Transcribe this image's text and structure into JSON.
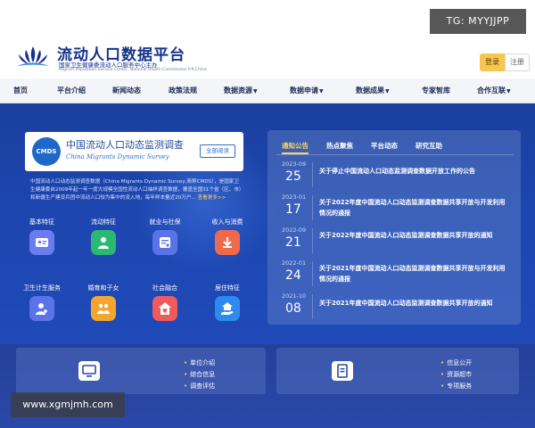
{
  "watermarks": {
    "top": "TG: MYYJJPP",
    "bottom": "www.xgmjmh.com"
  },
  "header": {
    "title": "流动人口数据平台",
    "subtitle": "国家卫生健康委流动人口服务中心主办",
    "subtitle_en": "Migrant Population Service Center, National Health Commission P.R.China",
    "login": "登录",
    "register": "注册"
  },
  "nav": {
    "items": [
      {
        "label": "首页",
        "dropdown": false
      },
      {
        "label": "平台介绍",
        "dropdown": false
      },
      {
        "label": "新闻动态",
        "dropdown": false
      },
      {
        "label": "政策法规",
        "dropdown": false
      },
      {
        "label": "数据资源",
        "dropdown": true
      },
      {
        "label": "数据申请",
        "dropdown": true
      },
      {
        "label": "数据成果",
        "dropdown": true
      },
      {
        "label": "专家智库",
        "dropdown": false
      },
      {
        "label": "合作互联",
        "dropdown": true
      }
    ]
  },
  "cmds": {
    "badge": "CMDS",
    "title": "中国流动人口动态监测调查",
    "title_en": "China Migrants Dynamic Survey",
    "read_all": "全部阅读",
    "description": "中国流动人口动态监测调查数据（China Migrants Dynamic Survey,简称CMDS），是国家卫生健康委自2009年起一年一度大规模全国性流动人口抽样调查数据，覆盖全国31个省（区、市）和新疆生产建设兵团中流动人口较为集中的流入地，每年样本量近20万户...",
    "more": "查看更多>>"
  },
  "categories": [
    {
      "label": "基本特征",
      "icon": "id-card-icon",
      "color": "#6b7cf0"
    },
    {
      "label": "流动特征",
      "icon": "people-icon",
      "color": "#2bb873"
    },
    {
      "label": "就业与社保",
      "icon": "document-icon",
      "color": "#5a74e8"
    },
    {
      "label": "收入与消费",
      "icon": "download-coin-icon",
      "color": "#ef6a4a"
    },
    {
      "label": "卫生计生服务",
      "icon": "health-person-icon",
      "color": "#5a74e8"
    },
    {
      "label": "婚育和子女",
      "icon": "family-icon",
      "color": "#f4a530"
    },
    {
      "label": "社会融合",
      "icon": "home-heart-icon",
      "color": "#ef5a5a"
    },
    {
      "label": "居住特征",
      "icon": "house-hand-icon",
      "color": "#2d8bef"
    }
  ],
  "notices": {
    "tabs": [
      {
        "label": "通知公告",
        "active": true
      },
      {
        "label": "热点聚焦",
        "active": false
      },
      {
        "label": "平台动态",
        "active": false
      },
      {
        "label": "研究互助",
        "active": false
      }
    ],
    "items": [
      {
        "ym": "2023-09",
        "day": "25",
        "text": "关于停止中国流动人口动态监测调查数据开放工作的公告"
      },
      {
        "ym": "2023-01",
        "day": "17",
        "text": "关于2022年度中国流动人口动态监测调查数据共享开放与开发利用情况的通报"
      },
      {
        "ym": "2022-09",
        "day": "21",
        "text": "关于2022年度中国流动人口动态监测调查数据共享开放的通知"
      },
      {
        "ym": "2022-01",
        "day": "24",
        "text": "关于2021年度中国流动人口动态监测调查数据共享开放与开发利用情况的通报"
      },
      {
        "ym": "2021-10",
        "day": "08",
        "text": "关于2021年度中国流动人口动态监测调查数据共享开放的通知"
      }
    ]
  },
  "services": {
    "left_links": [
      "单位介绍",
      "综合信息",
      "调查评估"
    ],
    "right_links": [
      "信息公开",
      "资源超市",
      "专项服务"
    ]
  },
  "colors": {
    "brand": "#14328c",
    "hero": "#1d46b0",
    "accent": "#ffd45a",
    "login": "#f6c64f"
  }
}
